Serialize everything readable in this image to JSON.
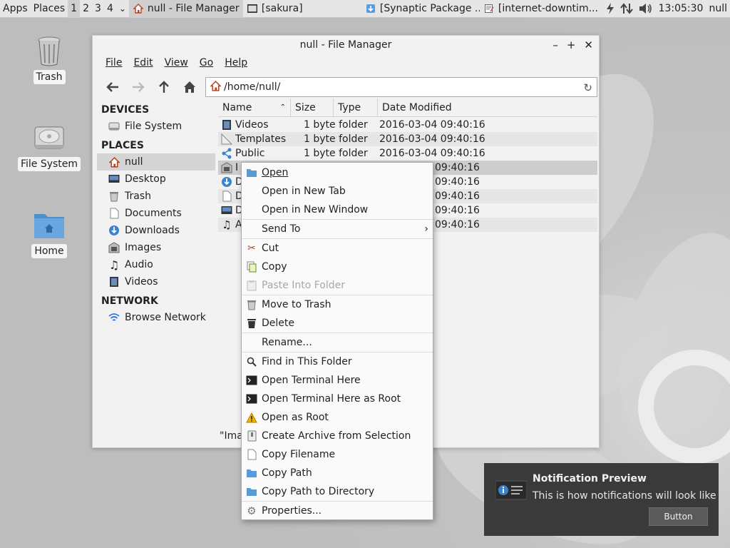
{
  "panel": {
    "apps": "Apps",
    "places": "Places",
    "workspaces": [
      "1",
      "2",
      "3",
      "4"
    ],
    "ws_chevron": "⌄",
    "tasks": [
      {
        "label": "null - File Manager",
        "icon": "home-icon"
      },
      {
        "label": "[sakura]",
        "icon": "terminal-icon"
      },
      {
        "label": "[Synaptic Package ...",
        "icon": "package-icon"
      },
      {
        "label": "[internet-downtim...",
        "icon": "text-editor-icon"
      }
    ],
    "clock": "13:05:30",
    "user": "null"
  },
  "desktop": {
    "icons": [
      {
        "label": "Trash",
        "icon": "trash-icon"
      },
      {
        "label": "File System",
        "icon": "drive-icon"
      },
      {
        "label": "Home",
        "icon": "home-folder-icon"
      }
    ]
  },
  "window": {
    "title": "null - File Manager",
    "menu": [
      "File",
      "Edit",
      "View",
      "Go",
      "Help"
    ],
    "path": "/home/null/",
    "sidebar": {
      "devices_header": "DEVICES",
      "devices": [
        {
          "label": "File System",
          "icon": "drive-icon"
        }
      ],
      "places_header": "PLACES",
      "places": [
        {
          "label": "null",
          "icon": "home-icon"
        },
        {
          "label": "Desktop",
          "icon": "desktop-icon"
        },
        {
          "label": "Trash",
          "icon": "trash-icon"
        },
        {
          "label": "Documents",
          "icon": "document-icon"
        },
        {
          "label": "Downloads",
          "icon": "download-icon"
        },
        {
          "label": "Images",
          "icon": "image-icon"
        },
        {
          "label": "Audio",
          "icon": "music-icon"
        },
        {
          "label": "Videos",
          "icon": "video-icon"
        }
      ],
      "network_header": "NETWORK",
      "network": [
        {
          "label": "Browse Network",
          "icon": "wifi-icon"
        }
      ]
    },
    "columns": [
      "Name",
      "Size",
      "Type",
      "Date Modified"
    ],
    "files": [
      {
        "name": "Videos",
        "size_type": "1 byte folder",
        "date": "2016-03-04 09:40:16",
        "icon": "video-icon"
      },
      {
        "name": "Templates",
        "size_type": "1 byte folder",
        "date": "2016-03-04 09:40:16",
        "icon": "template-icon"
      },
      {
        "name": "Public",
        "size_type": "1 byte folder",
        "date": "2016-03-04 09:40:16",
        "icon": "share-icon"
      },
      {
        "name": "I",
        "size_type": "",
        "date": "09:40:16",
        "icon": "image-icon"
      },
      {
        "name": "D",
        "size_type": "",
        "date": "09:40:16",
        "icon": "download-icon"
      },
      {
        "name": "D",
        "size_type": "",
        "date": "09:40:16",
        "icon": "document-icon"
      },
      {
        "name": "D",
        "size_type": "",
        "date": "09:40:16",
        "icon": "desktop-icon"
      },
      {
        "name": "A",
        "size_type": "",
        "date": "09:40:16",
        "icon": "music-icon"
      }
    ],
    "status": "\"Ima"
  },
  "context_menu": {
    "items": [
      {
        "label": "Open",
        "icon": "folder-icon",
        "group": 1
      },
      {
        "label": "Open in New Tab",
        "icon": "",
        "group": 1
      },
      {
        "label": "Open in New Window",
        "icon": "",
        "group": 1
      },
      {
        "label": "Send To",
        "icon": "",
        "group": 2,
        "submenu": true
      },
      {
        "label": "Cut",
        "icon": "scissors-icon",
        "group": 3
      },
      {
        "label": "Copy",
        "icon": "copy-icon",
        "group": 3
      },
      {
        "label": "Paste Into Folder",
        "icon": "paste-icon",
        "group": 3,
        "disabled": true
      },
      {
        "label": "Move to Trash",
        "icon": "trash-icon",
        "group": 4
      },
      {
        "label": "Delete",
        "icon": "delete-icon",
        "group": 4
      },
      {
        "label": "Rename...",
        "icon": "",
        "group": 5
      },
      {
        "label": "Find in This Folder",
        "icon": "search-icon",
        "group": 6
      },
      {
        "label": "Open Terminal Here",
        "icon": "terminal-icon",
        "group": 6
      },
      {
        "label": "Open Terminal Here as Root",
        "icon": "terminal-icon",
        "group": 6
      },
      {
        "label": "Open as Root",
        "icon": "warning-icon",
        "group": 6
      },
      {
        "label": "Create Archive from Selection",
        "icon": "archive-icon",
        "group": 6
      },
      {
        "label": "Copy Filename",
        "icon": "document-icon",
        "group": 6
      },
      {
        "label": "Copy Path",
        "icon": "folder-icon",
        "group": 6
      },
      {
        "label": "Copy Path to Directory",
        "icon": "folder-icon",
        "group": 6
      },
      {
        "label": "Properties...",
        "icon": "gear-icon",
        "group": 7
      }
    ],
    "submenu_arrow": "›"
  },
  "notification": {
    "title": "Notification Preview",
    "body": "This is how notifications will look like",
    "button": "Button"
  }
}
